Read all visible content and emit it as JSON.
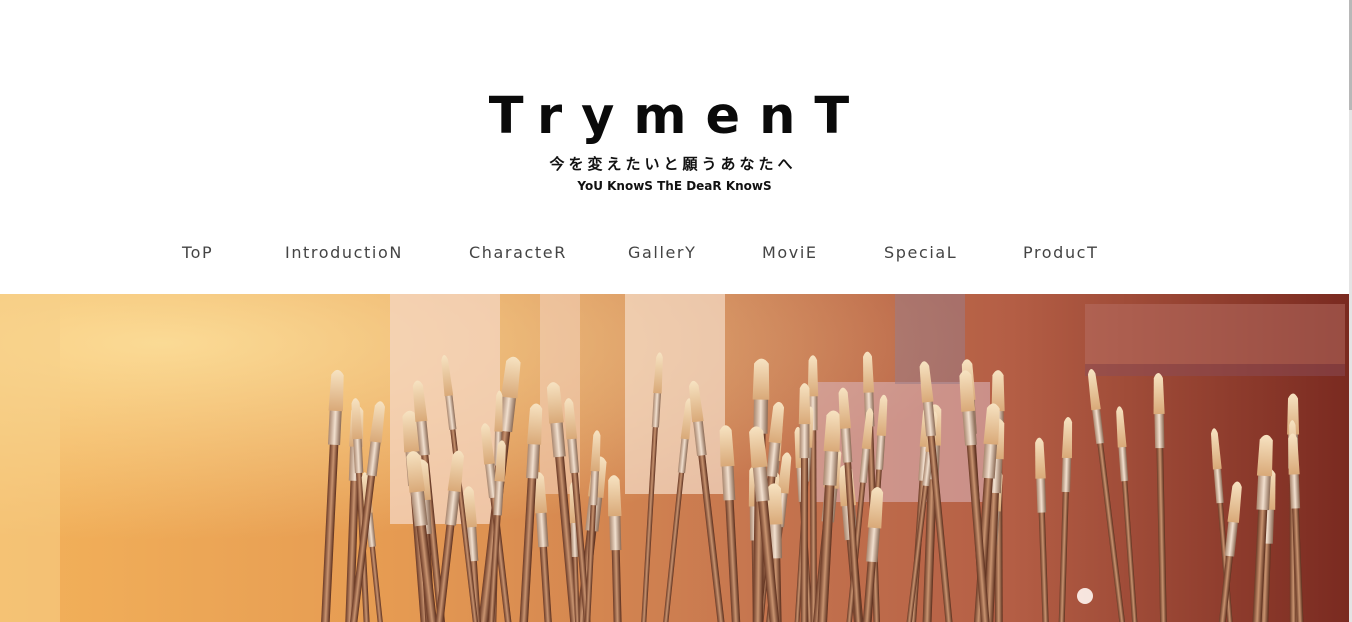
{
  "header": {
    "title": "TrymenT",
    "subtitle_jp": "今を変えたいと願うあなたへ",
    "subtitle_en": "YoU KnowS ThE DeaR KnowS"
  },
  "nav": {
    "items": [
      {
        "label": "ToP"
      },
      {
        "label": "IntroductioN"
      },
      {
        "label": "CharacteR"
      },
      {
        "label": "GallerY"
      },
      {
        "label": "MoviE"
      },
      {
        "label": "SpeciaL"
      },
      {
        "label": "ProducT"
      }
    ]
  },
  "hero": {
    "image_semantic": "paint-brushes-illustration"
  },
  "colors": {
    "title": "#0a0a0a",
    "nav_text": "#444444",
    "hero_light": "#f3b25a",
    "hero_dark": "#7a2a20"
  }
}
